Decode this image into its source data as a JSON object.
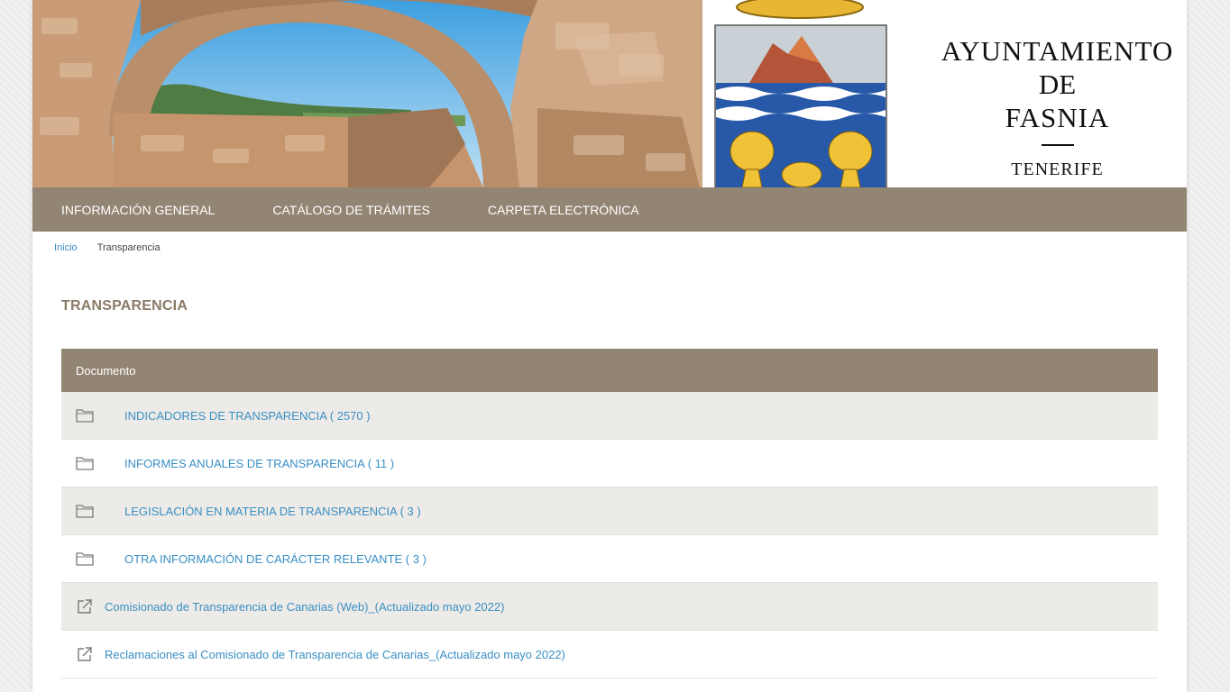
{
  "banner": {
    "town_line1": "AYUNTAMIENTO",
    "town_line2": "DE",
    "town_line3": "FASNIA",
    "town_sub": "TENERIFE"
  },
  "nav": {
    "items": [
      {
        "label": "INFORMACIÓN GENERAL"
      },
      {
        "label": "CATÁLOGO DE TRÁMITES"
      },
      {
        "label": "CARPETA ELECTRÓNICA"
      }
    ]
  },
  "breadcrumb": {
    "home": "Inicio",
    "current": "Transparencia"
  },
  "page_title": "TRANSPARENCIA",
  "table": {
    "header": "Documento",
    "rows": [
      {
        "icon": "folder-icon",
        "label": "INDICADORES DE TRANSPARENCIA ( 2570 )"
      },
      {
        "icon": "folder-icon",
        "label": "INFORMES ANUALES DE TRANSPARENCIA ( 11 )"
      },
      {
        "icon": "folder-icon",
        "label": "LEGISLACIÓN EN MATERIA DE TRANSPARENCIA ( 3 )"
      },
      {
        "icon": "folder-icon",
        "label": "OTRA INFORMACIÓN DE CARÁCTER RELEVANTE ( 3 )"
      },
      {
        "icon": "external-link-icon",
        "label": "Comisionado de Transparencia de Canarias (Web)_(Actualizado mayo 2022)"
      },
      {
        "icon": "external-link-icon",
        "label": "Reclamaciones al Comisionado de Transparencia de Canarias_(Actualizado mayo 2022)"
      }
    ]
  },
  "colors": {
    "accent_brown": "#938574",
    "title_brown": "#8b7b68",
    "link_blue": "#3a8fc4",
    "row_shade": "#edebe7"
  }
}
